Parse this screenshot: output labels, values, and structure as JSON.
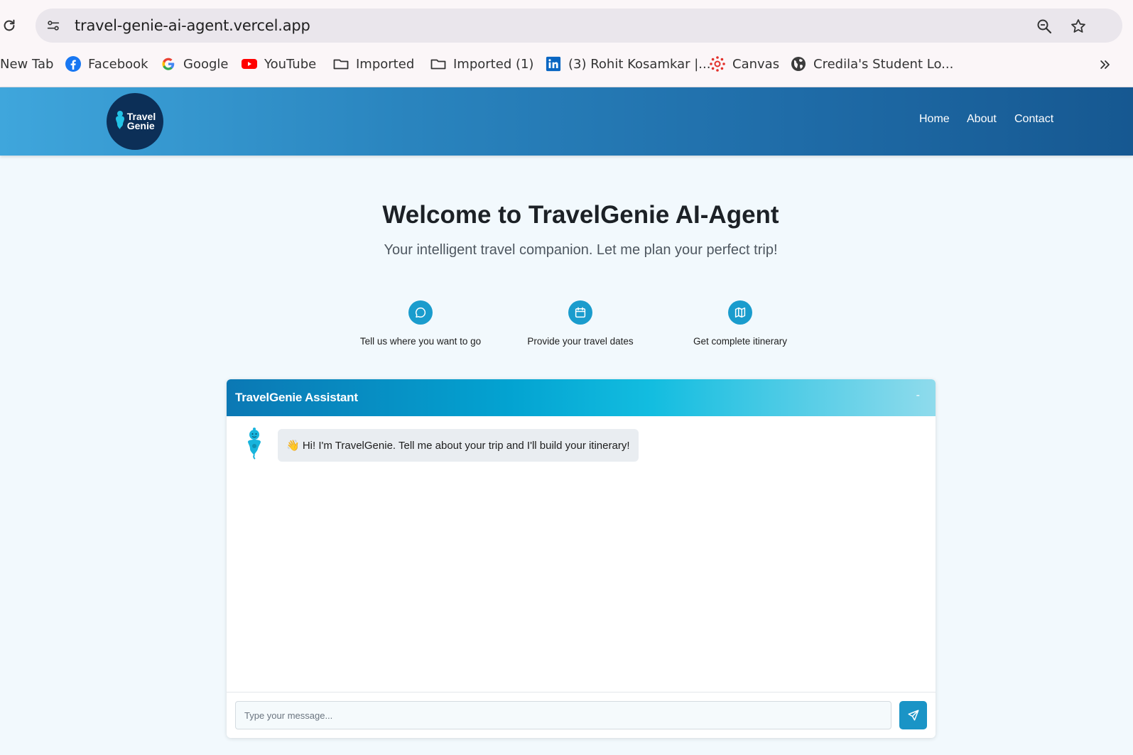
{
  "browser": {
    "url": "travel-genie-ai-agent.vercel.app",
    "bookmarks": [
      {
        "label": "New Tab",
        "icon": "none"
      },
      {
        "label": "Facebook",
        "icon": "facebook-icon"
      },
      {
        "label": "Google",
        "icon": "google-icon"
      },
      {
        "label": "YouTube",
        "icon": "youtube-icon"
      },
      {
        "label": "Imported",
        "icon": "folder-icon"
      },
      {
        "label": "Imported (1)",
        "icon": "folder-icon"
      },
      {
        "label": "(3) Rohit Kosamkar |...",
        "icon": "linkedin-icon"
      },
      {
        "label": "Canvas",
        "icon": "canvas-icon"
      },
      {
        "label": "Credila's Student Lo...",
        "icon": "globe-icon"
      }
    ]
  },
  "site": {
    "logo_line1": "Travel",
    "logo_line2": "Genie",
    "nav": [
      {
        "label": "Home"
      },
      {
        "label": "About"
      },
      {
        "label": "Contact"
      }
    ],
    "colors": {
      "header_start": "#3fa6dc",
      "header_end": "#165891",
      "accent": "#1a9ccd"
    }
  },
  "hero": {
    "title": "Welcome to TravelGenie AI-Agent",
    "subtitle": "Your intelligent travel companion. Let me plan your perfect trip!"
  },
  "steps": [
    {
      "icon": "chat-bubble-icon",
      "label": "Tell us where you want to go"
    },
    {
      "icon": "calendar-icon",
      "label": "Provide your travel dates"
    },
    {
      "icon": "map-icon",
      "label": "Get complete itinerary"
    }
  ],
  "chat": {
    "title": "TravelGenie Assistant",
    "minimize_label": "-",
    "messages": [
      {
        "sender": "bot",
        "text": "👋 Hi! I'm TravelGenie. Tell me about your trip and I'll build your itinerary!"
      }
    ],
    "input_placeholder": "Type your message...",
    "send_icon": "send-icon"
  }
}
